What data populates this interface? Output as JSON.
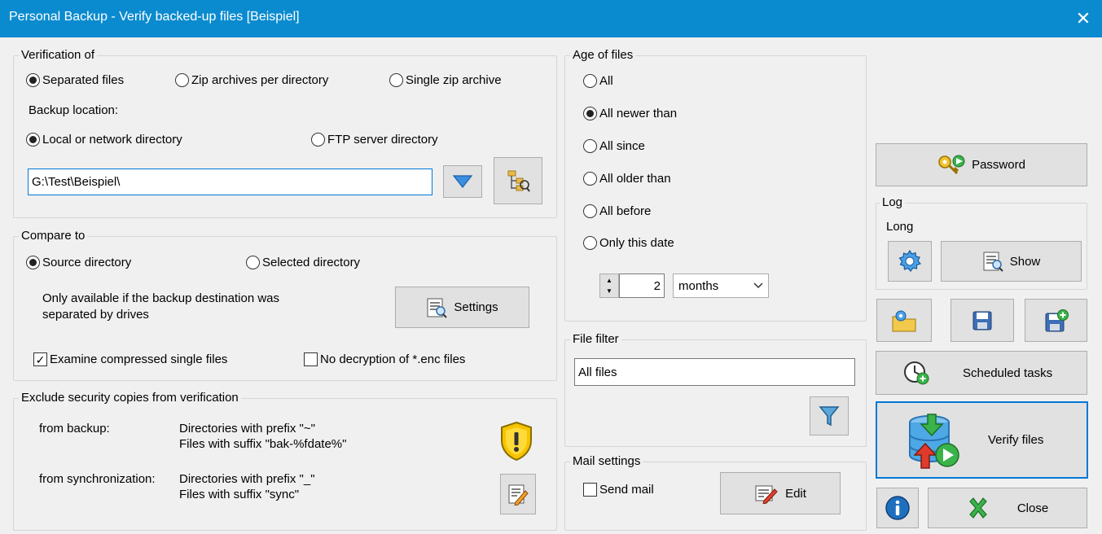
{
  "window": {
    "title": "Personal Backup - Verify backed-up files [Beispiel]",
    "close_glyph": "✕"
  },
  "verification": {
    "legend": "Verification of",
    "options": [
      "Separated files",
      "Zip archives per directory",
      "Single zip archive"
    ],
    "selected": 0,
    "backup_location_label": "Backup location:",
    "location_options": [
      "Local or network directory",
      "FTP server directory"
    ],
    "location_selected": 0,
    "path_value": "G:\\Test\\Beispiel\\"
  },
  "compare": {
    "legend": "Compare to",
    "options": [
      "Source directory",
      "Selected directory"
    ],
    "selected": 0,
    "note_line1": "Only available if the backup destination was",
    "note_line2": "separated by drives",
    "settings_label": "Settings",
    "examine_label": "Examine compressed single files",
    "examine_checked": true,
    "no_decrypt_label": "No decryption of *.enc files",
    "no_decrypt_checked": false
  },
  "exclude": {
    "legend": "Exclude security copies from verification",
    "backup_label": "from backup:",
    "backup_line1": "Directories with prefix \"~\"",
    "backup_line2": "Files with suffix \"bak-%fdate%\"",
    "sync_label": "from synchronization:",
    "sync_line1": "Directories with prefix \"_\"",
    "sync_line2": "Files with suffix \"sync\""
  },
  "age": {
    "legend": "Age of files",
    "options": [
      "All",
      "All newer than",
      "All since",
      "All older than",
      "All before",
      "Only this date"
    ],
    "selected": 1,
    "count_value": "2",
    "unit_value": "months"
  },
  "filter": {
    "legend": "File filter",
    "value": "All files"
  },
  "mail": {
    "legend": "Mail settings",
    "send_label": "Send mail",
    "send_checked": false,
    "edit_label": "Edit"
  },
  "right": {
    "password_label": "Password",
    "log_legend": "Log",
    "log_mode": "Long",
    "show_label": "Show",
    "scheduled_label": "Scheduled tasks",
    "verify_label": "Verify files",
    "close_label": "Close"
  },
  "colors": {
    "titlebar": "#0b8bcf",
    "accent": "#0078d7"
  }
}
